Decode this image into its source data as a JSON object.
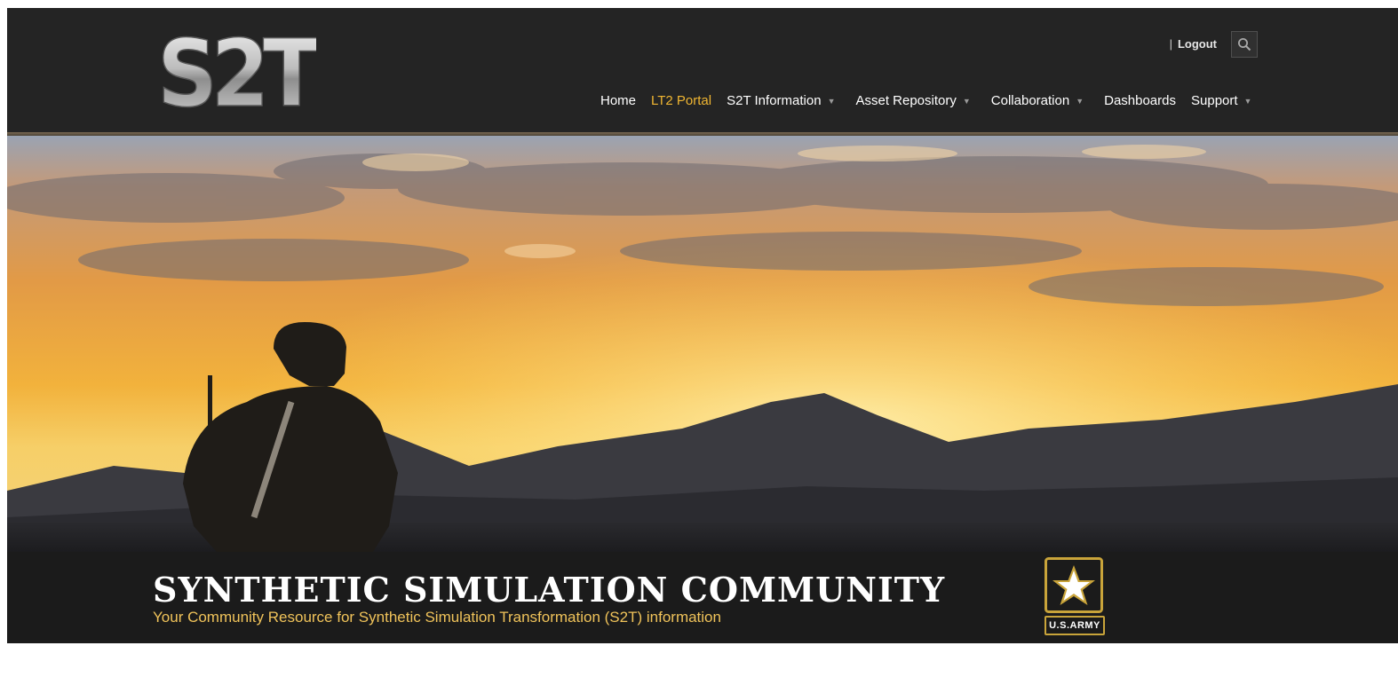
{
  "header": {
    "logo_text": "S2T",
    "utility": {
      "separator": "|",
      "logout_label": "Logout"
    },
    "search_icon": "search-icon",
    "nav": [
      {
        "label": "Home",
        "active": false,
        "has_dropdown": false
      },
      {
        "label": "LT2 Portal",
        "active": true,
        "has_dropdown": false
      },
      {
        "label": "S2T Information",
        "active": false,
        "has_dropdown": true
      },
      {
        "label": "Asset Repository",
        "active": false,
        "has_dropdown": true
      },
      {
        "label": "Collaboration",
        "active": false,
        "has_dropdown": true
      },
      {
        "label": "Dashboards",
        "active": false,
        "has_dropdown": false
      },
      {
        "label": "Support",
        "active": false,
        "has_dropdown": true
      }
    ],
    "caret_glyph": "▼"
  },
  "hero": {
    "image": "soldier-silhouette-at-sunset-over-mountains"
  },
  "banner": {
    "title": "SYNTHETIC SIMULATION COMMUNITY",
    "subtitle": "Your Community Resource for Synthetic Simulation Transformation (S2T) information",
    "logo_label": "U.S.ARMY"
  },
  "colors": {
    "header_bg": "#242424",
    "nav_active": "#f0b632",
    "banner_bg": "#1b1b1b",
    "subtitle": "#f0c35a",
    "army_gold": "#c9a43a"
  }
}
